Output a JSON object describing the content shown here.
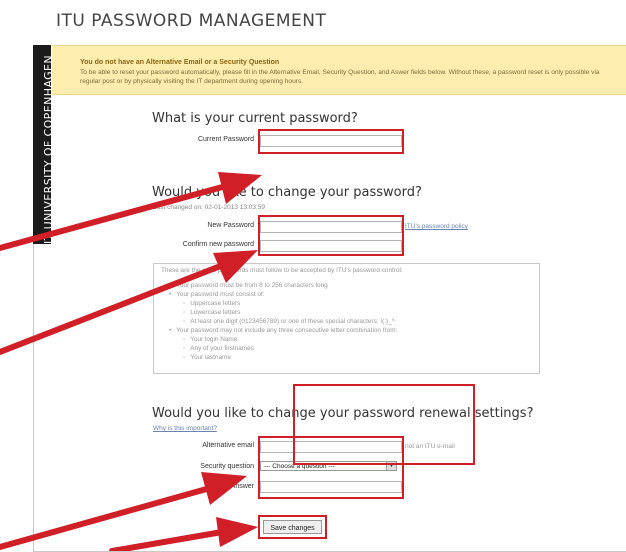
{
  "page": {
    "title": "ITU PASSWORD MANAGEMENT"
  },
  "sidebar": {
    "text": "IT UNIVERSITY OF COPENHAGEN"
  },
  "notice": {
    "title": "You do not have an Alternative Email or a Security Question",
    "body": "To be able to reset your password automatically, please fill in the Alternative Email, Security Question, and Aswer fields below. Without these, a password reset is only possible via regular post or by physically visiting the IT department during opening hours."
  },
  "current": {
    "heading": "What is your current password?",
    "label": "Current Password",
    "value": ""
  },
  "change": {
    "heading": "Would you like to change your password?",
    "last_changed": "Last changed on: 02-01-2013 13:03:59",
    "new_label": "New Password",
    "confirm_label": "Confirm new password",
    "policy_link": "ITU's password policy",
    "rules_intro": "These are the rules passwords must follow to be accepted by ITU's password control:",
    "rules": [
      {
        "level": 1,
        "text": "Your password must be from 8 to 256 characters long"
      },
      {
        "level": 1,
        "text": "Your password must consist of:"
      },
      {
        "level": 2,
        "text": "Uppercase letters"
      },
      {
        "level": 2,
        "text": "Lowercase letters"
      },
      {
        "level": 2,
        "text": "At least one digit (0123456789) or one of these special characters: !(:)_^"
      },
      {
        "level": 1,
        "text": "Your password may not include any three consecutive letter combination from:"
      },
      {
        "level": 2,
        "text": "Your login Name"
      },
      {
        "level": 2,
        "text": "Any of your firstnames"
      },
      {
        "level": 2,
        "text": "Your lastname"
      }
    ]
  },
  "renewal": {
    "heading": "Would you like to change your password renewal settings?",
    "why_link": "Why is this important?",
    "alt_email_label": "Alternative email",
    "alt_email_hint": "not an ITU e-mail",
    "security_label": "Security question",
    "security_selected": "--- Choose a question ---",
    "answer_label": "Answer",
    "save_label": "Save changes"
  },
  "colors": {
    "highlight": "#d01f26",
    "notice_bg": "#fdeeb0",
    "sidebar_bg": "#1b1b1b"
  },
  "icons": {
    "select_arrow": "chevron-down-icon"
  }
}
